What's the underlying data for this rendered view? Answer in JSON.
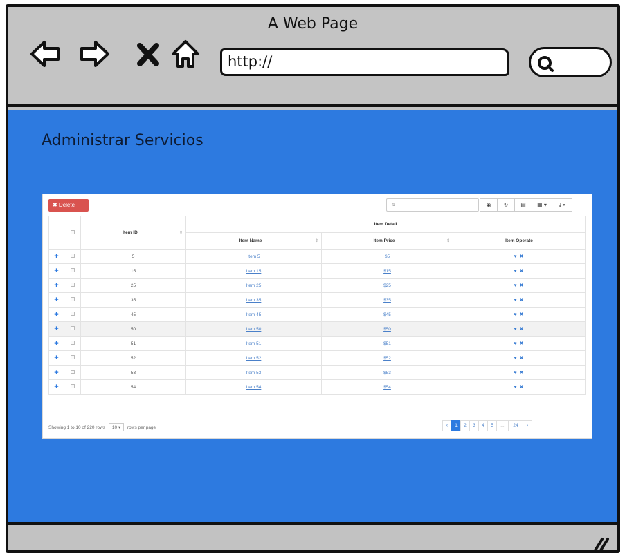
{
  "window": {
    "title": "A Web Page",
    "url": "http://"
  },
  "page": {
    "title": "Administrar Servicios"
  },
  "toolbar": {
    "delete_label": "✖ Delete",
    "search_value": "5",
    "icons": [
      "eye-icon",
      "refresh-icon",
      "list-icon",
      "columns-icon",
      "export-icon"
    ]
  },
  "table": {
    "group_header": "Item Detail",
    "headers": {
      "item_id": "Item ID",
      "item_name": "Item Name",
      "item_price": "Item Price",
      "item_operate": "Item Operate"
    },
    "rows": [
      {
        "id": "5",
        "name": "Item 5",
        "price": "$5"
      },
      {
        "id": "15",
        "name": "Item 15",
        "price": "$15"
      },
      {
        "id": "25",
        "name": "Item 25",
        "price": "$25"
      },
      {
        "id": "35",
        "name": "Item 35",
        "price": "$35"
      },
      {
        "id": "45",
        "name": "Item 45",
        "price": "$45"
      },
      {
        "id": "50",
        "name": "Item 50",
        "price": "$50"
      },
      {
        "id": "51",
        "name": "Item 51",
        "price": "$51"
      },
      {
        "id": "52",
        "name": "Item 52",
        "price": "$52"
      },
      {
        "id": "53",
        "name": "Item 53",
        "price": "$53"
      },
      {
        "id": "54",
        "name": "Item 54",
        "price": "$54"
      }
    ],
    "highlighted_row": 5,
    "ops_glyphs": "♥ ✖"
  },
  "footer": {
    "showing_text": "Showing 1 to 10 of 220 rows",
    "page_size": "10 ▾",
    "rows_per_page_text": "rows per page"
  },
  "pagination": {
    "prev": "‹",
    "pages": [
      "1",
      "2",
      "3",
      "4",
      "5"
    ],
    "ellipsis": "...",
    "last": "24",
    "next": "›",
    "active_page": "1"
  },
  "colors": {
    "content_background": "#2d7ae0",
    "delete_button": "#d9534f",
    "active_page": "#2d7ae0"
  }
}
